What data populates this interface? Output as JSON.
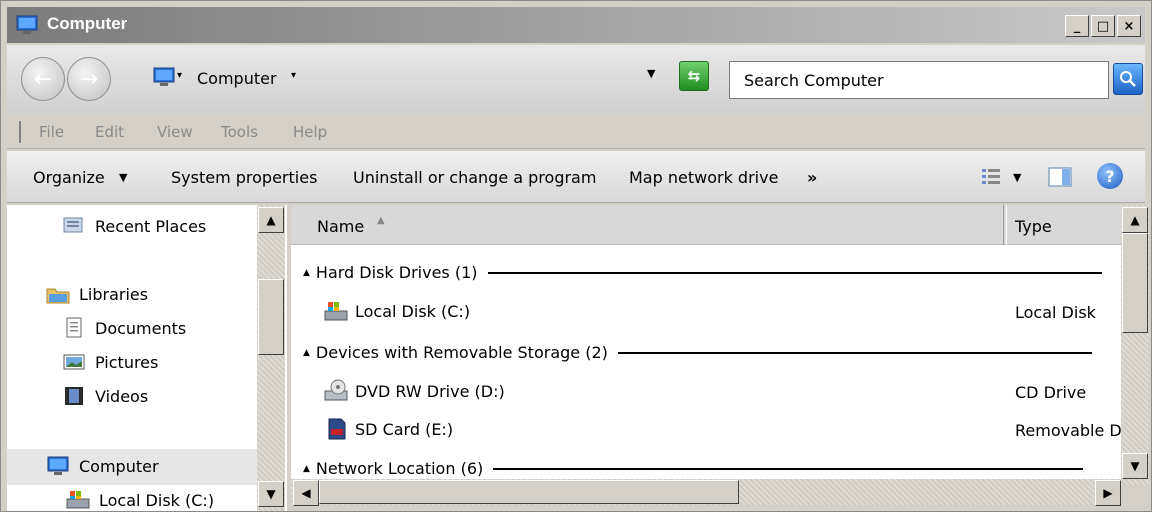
{
  "window": {
    "title": "Computer",
    "minimize_label": "_",
    "maximize_label": "□",
    "close_label": "×"
  },
  "address": {
    "location": "Computer",
    "search_placeholder": "Search Computer"
  },
  "menu": [
    "File",
    "Edit",
    "View",
    "Tools",
    "Help"
  ],
  "commands": {
    "organize": "Organize",
    "system_properties": "System properties",
    "uninstall": "Uninstall or change a program",
    "map_drive": "Map network drive",
    "more": "»"
  },
  "nav": {
    "recent_places": "Recent Places",
    "libraries": "Libraries",
    "documents": "Documents",
    "pictures": "Pictures",
    "videos": "Videos",
    "computer": "Computer",
    "local_disk": "Local Disk (C:)"
  },
  "columns": {
    "name": "Name",
    "type": "Type"
  },
  "groups": {
    "hard_disk": "Hard Disk Drives (1)",
    "removable": "Devices with Removable Storage (2)",
    "network": "Network Location (6)"
  },
  "items": [
    {
      "name": "Local Disk (C:)",
      "type": "Local Disk",
      "icon": "local-disk-icon"
    },
    {
      "name": "DVD RW Drive (D:)",
      "type": "CD Drive",
      "icon": "dvd-drive-icon"
    },
    {
      "name": "SD Card (E:)",
      "type": "Removable D",
      "icon": "sd-card-icon"
    }
  ]
}
